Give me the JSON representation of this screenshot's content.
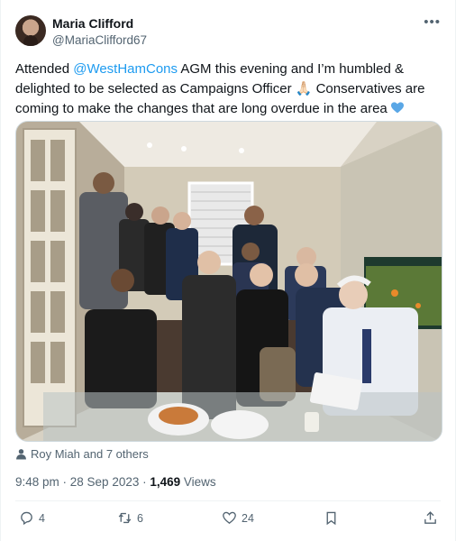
{
  "author": {
    "name": "Maria Clifford",
    "handle": "@MariaClifford67"
  },
  "menu_icon": "more-dots-icon",
  "tweet": {
    "text_before": "Attended ",
    "mention": "@WestHamCons",
    "text_after": " AGM this evening and I’m humbled & delighted to be selected as Campaigns Officer 🙏🏻 Conservatives are coming to make the changes that are long overdue in the area ",
    "heart_color": "#5aa7e6"
  },
  "tagged": "Roy Miah and 7 others",
  "meta": {
    "time_date": "9:48 pm · 28 Sep 2023 · ",
    "views_count": "1,469",
    "views_label": " Views"
  },
  "actions": {
    "replies": "4",
    "reposts": "6",
    "likes": "24"
  },
  "colors": {
    "link": "#1d9bf0",
    "secondary_text": "#536471"
  }
}
